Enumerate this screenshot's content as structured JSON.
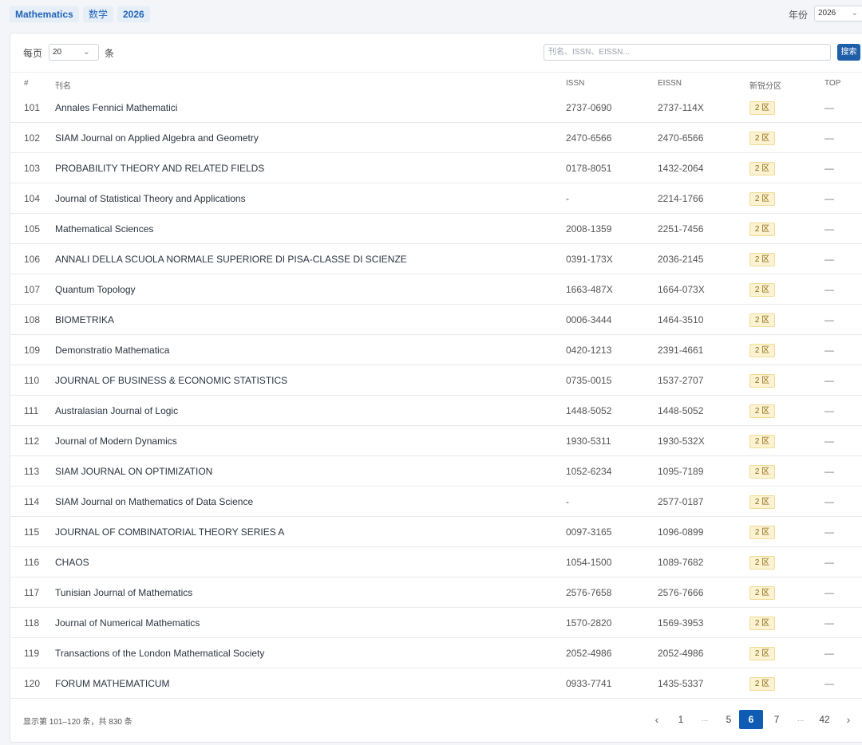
{
  "topbar": {
    "tags": [
      "Mathematics",
      "数学",
      "2026"
    ],
    "year_label": "年份",
    "year_value": "2026"
  },
  "toolbar": {
    "per_page_label": "每页",
    "per_page_value": "20",
    "per_page_unit": "条",
    "search_placeholder": "刊名、ISSN、EISSN...",
    "search_button": "搜索"
  },
  "table": {
    "headers": {
      "num": "#",
      "name": "刊名",
      "issn": "ISSN",
      "eissn": "EISSN",
      "zone": "新锐分区",
      "top": "TOP"
    },
    "rows": [
      {
        "num": "101",
        "name": "Annales Fennici Mathematici",
        "issn": "2737-0690",
        "eissn": "2737-114X",
        "zone": "2 区",
        "top": "—"
      },
      {
        "num": "102",
        "name": "SIAM Journal on Applied Algebra and Geometry",
        "issn": "2470-6566",
        "eissn": "2470-6566",
        "zone": "2 区",
        "top": "—"
      },
      {
        "num": "103",
        "name": "PROBABILITY THEORY AND RELATED FIELDS",
        "issn": "0178-8051",
        "eissn": "1432-2064",
        "zone": "2 区",
        "top": "—"
      },
      {
        "num": "104",
        "name": "Journal of Statistical Theory and Applications",
        "issn": "-",
        "eissn": "2214-1766",
        "zone": "2 区",
        "top": "—"
      },
      {
        "num": "105",
        "name": "Mathematical Sciences",
        "issn": "2008-1359",
        "eissn": "2251-7456",
        "zone": "2 区",
        "top": "—"
      },
      {
        "num": "106",
        "name": "ANNALI DELLA SCUOLA NORMALE SUPERIORE DI PISA-CLASSE DI SCIENZE",
        "issn": "0391-173X",
        "eissn": "2036-2145",
        "zone": "2 区",
        "top": "—"
      },
      {
        "num": "107",
        "name": "Quantum Topology",
        "issn": "1663-487X",
        "eissn": "1664-073X",
        "zone": "2 区",
        "top": "—"
      },
      {
        "num": "108",
        "name": "BIOMETRIKA",
        "issn": "0006-3444",
        "eissn": "1464-3510",
        "zone": "2 区",
        "top": "—"
      },
      {
        "num": "109",
        "name": "Demonstratio Mathematica",
        "issn": "0420-1213",
        "eissn": "2391-4661",
        "zone": "2 区",
        "top": "—"
      },
      {
        "num": "110",
        "name": "JOURNAL OF BUSINESS & ECONOMIC STATISTICS",
        "issn": "0735-0015",
        "eissn": "1537-2707",
        "zone": "2 区",
        "top": "—"
      },
      {
        "num": "111",
        "name": "Australasian Journal of Logic",
        "issn": "1448-5052",
        "eissn": "1448-5052",
        "zone": "2 区",
        "top": "—"
      },
      {
        "num": "112",
        "name": "Journal of Modern Dynamics",
        "issn": "1930-5311",
        "eissn": "1930-532X",
        "zone": "2 区",
        "top": "—"
      },
      {
        "num": "113",
        "name": "SIAM JOURNAL ON OPTIMIZATION",
        "issn": "1052-6234",
        "eissn": "1095-7189",
        "zone": "2 区",
        "top": "—"
      },
      {
        "num": "114",
        "name": "SIAM Journal on Mathematics of Data Science",
        "issn": "-",
        "eissn": "2577-0187",
        "zone": "2 区",
        "top": "—"
      },
      {
        "num": "115",
        "name": "JOURNAL OF COMBINATORIAL THEORY SERIES A",
        "issn": "0097-3165",
        "eissn": "1096-0899",
        "zone": "2 区",
        "top": "—"
      },
      {
        "num": "116",
        "name": "CHAOS",
        "issn": "1054-1500",
        "eissn": "1089-7682",
        "zone": "2 区",
        "top": "—"
      },
      {
        "num": "117",
        "name": "Tunisian Journal of Mathematics",
        "issn": "2576-7658",
        "eissn": "2576-7666",
        "zone": "2 区",
        "top": "—"
      },
      {
        "num": "118",
        "name": "Journal of Numerical Mathematics",
        "issn": "1570-2820",
        "eissn": "1569-3953",
        "zone": "2 区",
        "top": "—"
      },
      {
        "num": "119",
        "name": "Transactions of the London Mathematical Society",
        "issn": "2052-4986",
        "eissn": "2052-4986",
        "zone": "2 区",
        "top": "—"
      },
      {
        "num": "120",
        "name": "FORUM MATHEMATICUM",
        "issn": "0933-7741",
        "eissn": "1435-5337",
        "zone": "2 区",
        "top": "—"
      }
    ]
  },
  "footer": {
    "summary": "显示第 101–120 条，共 830 条",
    "pages": [
      {
        "label": "‹",
        "kind": "prev-icon"
      },
      {
        "label": "1",
        "kind": "page"
      },
      {
        "label": "...",
        "kind": "ellipsis"
      },
      {
        "label": "5",
        "kind": "page"
      },
      {
        "label": "6",
        "kind": "active"
      },
      {
        "label": "7",
        "kind": "page"
      },
      {
        "label": "...",
        "kind": "ellipsis"
      },
      {
        "label": "42",
        "kind": "page"
      },
      {
        "label": "›",
        "kind": "next-icon"
      }
    ]
  },
  "colors": {
    "accent": "#0f5cb4",
    "zone_badge_bg": "#fdf3d3",
    "tag_bg": "#e6eef8"
  }
}
